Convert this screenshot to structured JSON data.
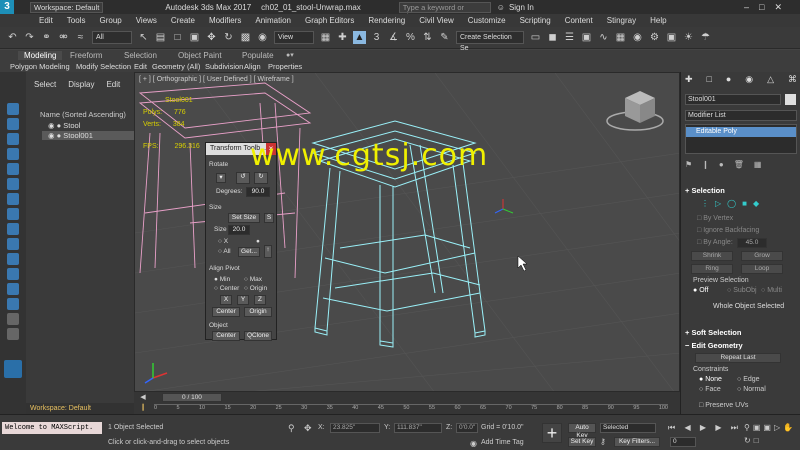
{
  "titlebar": {
    "app_icon": "3",
    "workspace": "Workspace: Default",
    "app_title": "Autodesk 3ds Max 2017",
    "file_title": "ch02_01_stool-Unwrap.max",
    "search_placeholder": "Type a keyword or phrase",
    "signin": "Sign In"
  },
  "menubar": {
    "items": [
      "Edit",
      "Tools",
      "Group",
      "Views",
      "Create",
      "Modifiers",
      "Animation",
      "Graph Editors",
      "Rendering",
      "Civil View",
      "Customize",
      "Scripting",
      "Content",
      "Stingray",
      "Help"
    ]
  },
  "toolbar": {
    "filter": "All",
    "refcoord": "View",
    "selection_set": "Create Selection Se"
  },
  "ribbon": {
    "tabs": [
      "Modeling",
      "Freeform",
      "Selection",
      "Object Paint",
      "Populate"
    ],
    "subtabs": [
      "Polygon Modeling",
      "Modify Selection",
      "Edit",
      "Geometry (All)",
      "Subdivision",
      "Align",
      "Properties"
    ]
  },
  "scene_explorer": {
    "menu": [
      "Select",
      "Display",
      "Edit"
    ],
    "header": "Name (Sorted Ascending)",
    "items": [
      "Stool",
      "Stool001"
    ]
  },
  "viewport": {
    "label": "[ + ] [ Orthographic ] [ User Defined ] [ Wireframe ]",
    "stats": {
      "object": "Stool001",
      "polys_label": "Polys:",
      "polys": "776",
      "verts_label": "Verts:",
      "verts": "384",
      "fps_label": "FPS:",
      "fps": "296.316"
    }
  },
  "watermark": "www.cgtsj.com",
  "transform_toolbox": {
    "title": "Transform Toolb...",
    "rotate_label": "Rotate",
    "degrees_label": "Degrees:",
    "degrees_value": "90.0",
    "size_label": "Size",
    "set_size": "Set Size",
    "size2": "Size",
    "size_value": "20.0",
    "x_label": "X",
    "all_label": "All",
    "get_label": "Get...",
    "align_pivot": "Align Pivot",
    "min": "Min",
    "max": "Max",
    "center": "Center",
    "origin": "Origin",
    "axes": [
      "X",
      "Y",
      "Z"
    ],
    "center_btn": "Center",
    "origin_btn": "Origin",
    "object_label": "Object",
    "object_center": "Center",
    "qclone": "QClone"
  },
  "command_panel": {
    "object_name": "Stool001",
    "modifier_list": "Modifier List",
    "modifier": "Editable Poly",
    "selection_head": "Selection",
    "by_vertex": "By Vertex",
    "ignore_backfacing": "Ignore Backfacing",
    "by_angle": "By Angle:",
    "by_angle_value": "45.0",
    "shrink": "Shrink",
    "grow": "Grow",
    "ring": "Ring",
    "loop": "Loop",
    "preview_selection": "Preview Selection",
    "off": "Off",
    "subobj": "SubObj",
    "multi": "Multi",
    "whole_selected": "Whole Object Selected",
    "soft_selection": "Soft Selection",
    "edit_geometry": "Edit Geometry",
    "repeat_last": "Repeat Last",
    "constraints": "Constraints",
    "none": "None",
    "edge": "Edge",
    "face": "Face",
    "normal": "Normal",
    "preserve_uvs": "Preserve UVs"
  },
  "timeline": {
    "frame": "0 / 100",
    "ticks": [
      "0",
      "5",
      "10",
      "15",
      "20",
      "25",
      "30",
      "35",
      "40",
      "45",
      "50",
      "55",
      "60",
      "65",
      "70",
      "75",
      "80",
      "85",
      "90",
      "95",
      "100"
    ]
  },
  "statusbar": {
    "workspace": "Workspace: Default",
    "maxscript": "Welcome to MAXScript.",
    "selected": "1 Object Selected",
    "hint": "Click or click-and-drag to select objects",
    "x_label": "X:",
    "x_value": "23.825\"",
    "y_label": "Y:",
    "y_value": "111.837\"",
    "z_label": "Z:",
    "z_value": "0'0.0\"",
    "grid": "Grid = 0'10.0\"",
    "add_time_tag": "Add Time Tag",
    "auto_key": "Auto Key",
    "selected_drop": "Selected",
    "set_key": "Set Key",
    "key_filters": "Key Filters...",
    "frame_value": "0"
  }
}
